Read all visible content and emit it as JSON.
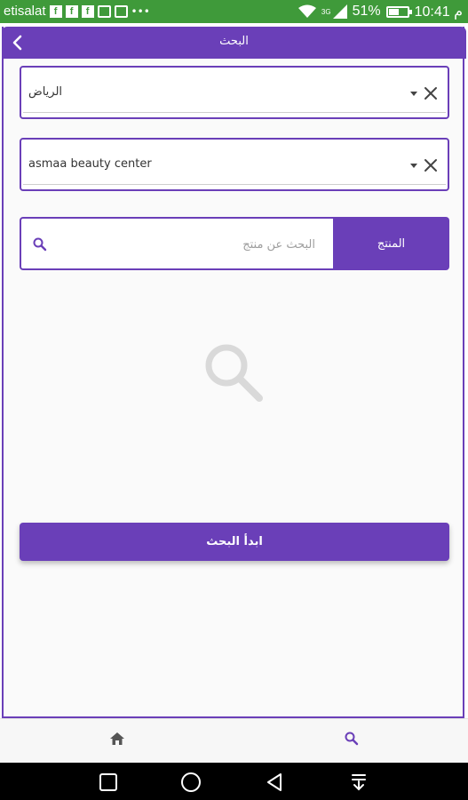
{
  "status_bar": {
    "carrier": "etisalat",
    "network_type": "3G",
    "battery": "51%",
    "battery_level": 0.51,
    "time": "10:41 م"
  },
  "header": {
    "title": "البحث",
    "back_icon": "chevron-left-icon"
  },
  "filters": {
    "city": {
      "value": "الرياض"
    },
    "center": {
      "value": "asmaa beauty center"
    }
  },
  "search": {
    "placeholder": "البحث عن منتج",
    "product_button_label": "المنتج"
  },
  "empty_state": {
    "icon": "search-icon"
  },
  "start_button": {
    "label": "ابدأ البحث"
  },
  "bottom_nav": [
    {
      "icon": "home-icon",
      "active": false
    },
    {
      "icon": "search-icon",
      "active": true
    }
  ],
  "colors": {
    "accent": "#6a3fb8",
    "status_bar": "#3f9a3a",
    "active_nav": "#6a3fb8",
    "inactive_nav": "#555555"
  }
}
